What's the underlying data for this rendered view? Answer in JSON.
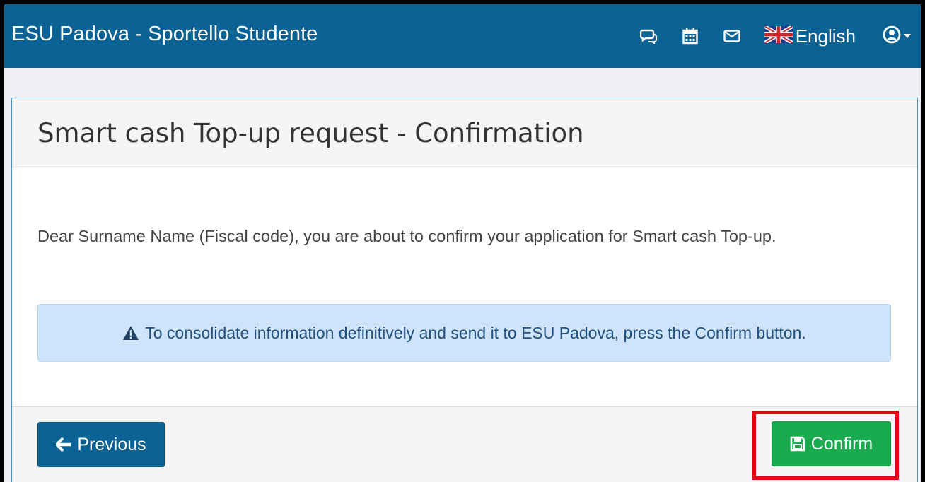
{
  "navbar": {
    "brand": "ESU Padova - Sportello Studente",
    "items": [
      {
        "icon": "chat-icon"
      },
      {
        "icon": "calendar-icon"
      },
      {
        "icon": "envelope-icon"
      },
      {
        "icon": "uk-flag-icon",
        "label": "English"
      },
      {
        "icon": "user-circle-icon",
        "dropdown": true
      }
    ],
    "background_color": "#0b6294"
  },
  "panel": {
    "title": "Smart cash Top-up request - Confirmation",
    "intro": "Dear Surname Name (Fiscal code), you are about to confirm your application for Smart cash Top-up.",
    "alert": {
      "icon": "warning-triangle-icon",
      "text": "To consolidate information definitively and send it to ESU Padova, press the Confirm button.",
      "background_color": "#cfe4fa"
    },
    "footer": {
      "previous_label": "Previous",
      "previous_icon": "arrow-left-icon",
      "confirm_label": "Confirm",
      "confirm_icon": "save-icon",
      "confirm_color": "#1aab4f",
      "highlight_color": "#e4000f"
    }
  }
}
